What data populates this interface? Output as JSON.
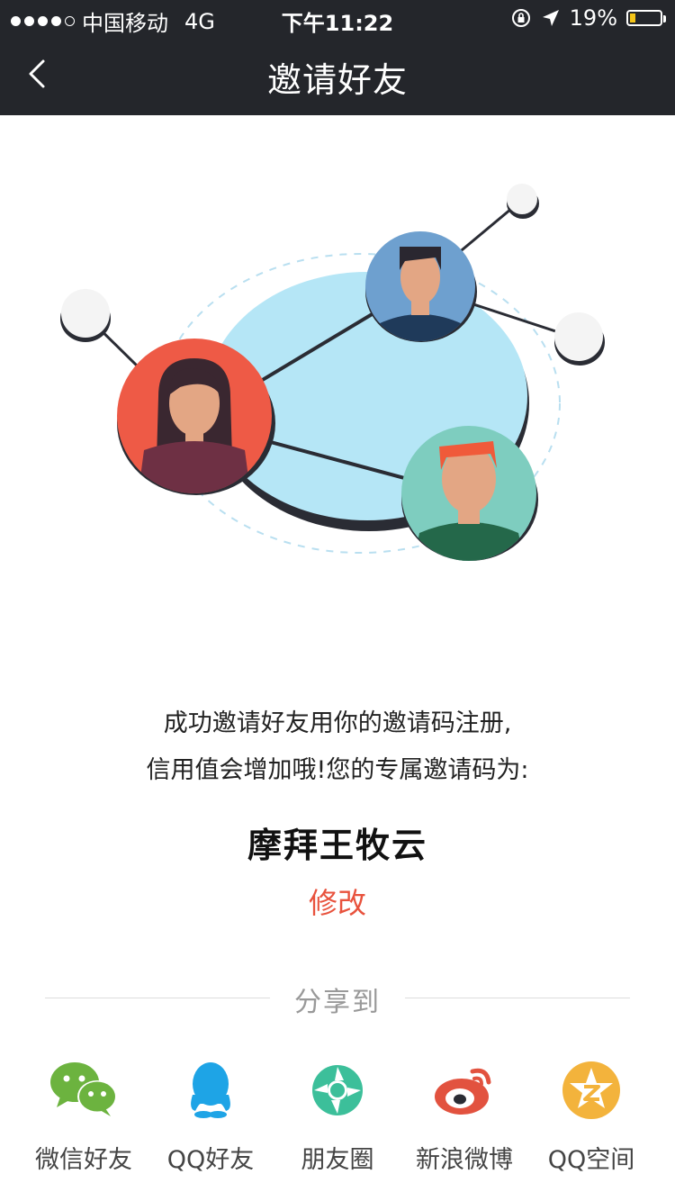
{
  "status_bar": {
    "carrier": "中国移动",
    "network": "4G",
    "time": "下午11:22",
    "battery_percent": "19%",
    "battery_level": 0.19
  },
  "header": {
    "title": "邀请好友"
  },
  "main": {
    "description_line1": "成功邀请好友用你的邀请码注册,",
    "description_line2": "信用值会增加哦!您的专属邀请码为:",
    "invite_code": "摩拜王牧云",
    "edit_label": "修改"
  },
  "share": {
    "label": "分享到",
    "items": [
      {
        "label": "微信好友",
        "icon": "wechat-icon"
      },
      {
        "label": "QQ好友",
        "icon": "qq-icon"
      },
      {
        "label": "朋友圈",
        "icon": "moments-icon"
      },
      {
        "label": "新浪微博",
        "icon": "weibo-icon"
      },
      {
        "label": "QQ空间",
        "icon": "qzone-icon"
      }
    ]
  },
  "colors": {
    "header_bg": "#24262b",
    "accent": "#e8523d"
  }
}
